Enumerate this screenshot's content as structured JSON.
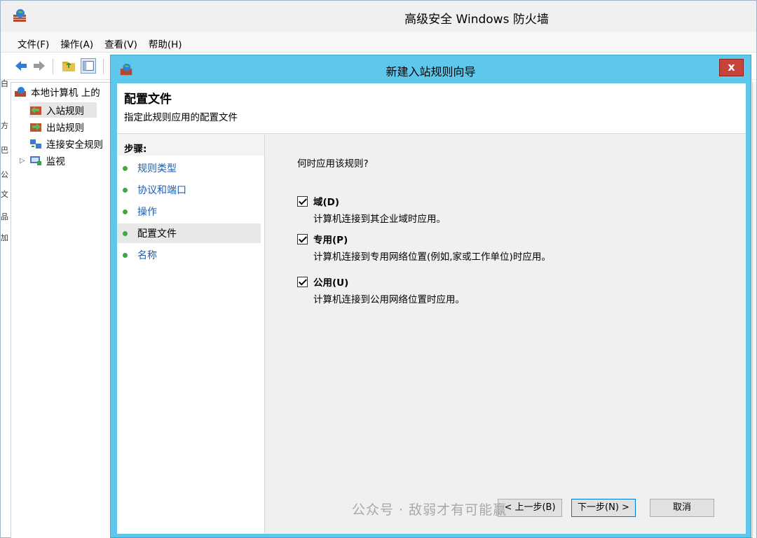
{
  "main_window": {
    "title": "高级安全 Windows 防火墙",
    "menu": [
      "文件(F)",
      "操作(A)",
      "查看(V)",
      "帮助(H)"
    ]
  },
  "tree": {
    "root": "本地计算机 上的",
    "items": [
      "入站规则",
      "出站规则",
      "连接安全规则",
      "监视"
    ]
  },
  "left_edge_fragments": [
    "白",
    "方",
    "巴",
    "公",
    "文",
    "品",
    "加"
  ],
  "wizard": {
    "title": "新建入站规则向导",
    "close_label": "x",
    "header_title": "配置文件",
    "header_subtitle": "指定此规则应用的配置文件",
    "steps_title": "步骤:",
    "steps": [
      {
        "label": "规则类型",
        "state": "link"
      },
      {
        "label": "协议和端口",
        "state": "link"
      },
      {
        "label": "操作",
        "state": "link"
      },
      {
        "label": "配置文件",
        "state": "current"
      },
      {
        "label": "名称",
        "state": "link"
      }
    ],
    "question": "何时应用该规则?",
    "options": [
      {
        "label": "域(D)",
        "desc": "计算机连接到其企业域时应用。",
        "checked": true
      },
      {
        "label": "专用(P)",
        "desc": "计算机连接到专用网络位置(例如,家或工作单位)时应用。",
        "checked": true
      },
      {
        "label": "公用(U)",
        "desc": "计算机连接到公用网络位置时应用。",
        "checked": true
      }
    ],
    "buttons": {
      "back": "< 上一步(B)",
      "next": "下一步(N) >",
      "cancel": "取消"
    }
  },
  "watermark": "公众号 · 敌弱才有可能赢",
  "colors": {
    "wizard_frame": "#5ec8ec",
    "close_button": "#c7423a",
    "step_dot": "#3fa83f",
    "step_link": "#1a5fb4"
  }
}
